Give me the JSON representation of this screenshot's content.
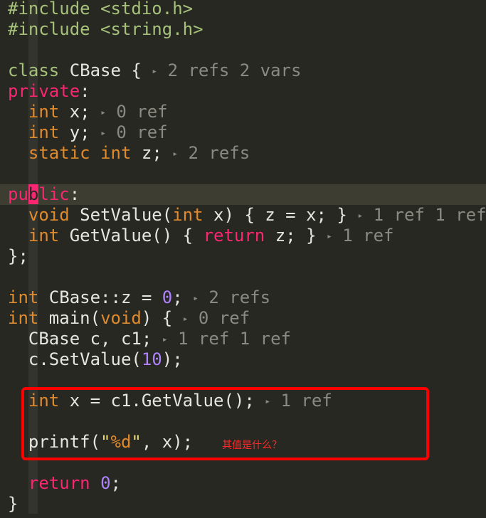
{
  "lines": [
    [
      {
        "c": "t-include",
        "t": "#include "
      },
      {
        "c": "t-include",
        "t": "<stdio.h>"
      }
    ],
    [
      {
        "c": "t-include",
        "t": "#include "
      },
      {
        "c": "t-include",
        "t": "<string.h>"
      }
    ],
    [],
    [
      {
        "c": "t-class",
        "t": "class "
      },
      {
        "c": "t-plain",
        "t": "CBase { "
      },
      {
        "c": "t-arrow",
        "t": "▸"
      },
      {
        "c": "t-hint",
        "t": " 2 refs 2 vars"
      }
    ],
    [
      {
        "c": "t-kw",
        "t": "private"
      },
      {
        "c": "t-plain",
        "t": ":"
      }
    ],
    [
      {
        "c": "t-plain",
        "t": "  "
      },
      {
        "c": "t-type",
        "t": "int"
      },
      {
        "c": "t-plain",
        "t": " x; "
      },
      {
        "c": "t-arrow",
        "t": "▸"
      },
      {
        "c": "t-hint",
        "t": " 0 ref"
      }
    ],
    [
      {
        "c": "t-plain",
        "t": "  "
      },
      {
        "c": "t-type",
        "t": "int"
      },
      {
        "c": "t-plain",
        "t": " y; "
      },
      {
        "c": "t-arrow",
        "t": "▸"
      },
      {
        "c": "t-hint",
        "t": " 0 ref"
      }
    ],
    [
      {
        "c": "t-plain",
        "t": "  "
      },
      {
        "c": "t-type",
        "t": "static"
      },
      {
        "c": "t-plain",
        "t": " "
      },
      {
        "c": "t-type",
        "t": "int"
      },
      {
        "c": "t-plain",
        "t": " z; "
      },
      {
        "c": "t-arrow",
        "t": "▸"
      },
      {
        "c": "t-hint",
        "t": " 2 refs"
      }
    ],
    [],
    [
      {
        "c": "t-kw",
        "t": "pu"
      },
      {
        "c": "t-kw cursor-block",
        "t": "b"
      },
      {
        "c": "t-kw",
        "t": "lic"
      },
      {
        "c": "t-plain",
        "t": ":"
      }
    ],
    [
      {
        "c": "t-plain",
        "t": "  "
      },
      {
        "c": "t-type",
        "t": "void"
      },
      {
        "c": "t-plain",
        "t": " SetValue("
      },
      {
        "c": "t-type",
        "t": "int"
      },
      {
        "c": "t-plain",
        "t": " x) { z = x; } "
      },
      {
        "c": "t-arrow",
        "t": "▸"
      },
      {
        "c": "t-hint",
        "t": " 1 ref 1 ref"
      }
    ],
    [
      {
        "c": "t-plain",
        "t": "  "
      },
      {
        "c": "t-type",
        "t": "int"
      },
      {
        "c": "t-plain",
        "t": " GetValue() { "
      },
      {
        "c": "t-kw",
        "t": "return"
      },
      {
        "c": "t-plain",
        "t": " z; } "
      },
      {
        "c": "t-arrow",
        "t": "▸"
      },
      {
        "c": "t-hint",
        "t": " 1 ref"
      }
    ],
    [
      {
        "c": "t-plain",
        "t": "};"
      }
    ],
    [],
    [
      {
        "c": "t-type",
        "t": "int"
      },
      {
        "c": "t-plain",
        "t": " CBase::z = "
      },
      {
        "c": "t-num",
        "t": "0"
      },
      {
        "c": "t-plain",
        "t": "; "
      },
      {
        "c": "t-arrow",
        "t": "▸"
      },
      {
        "c": "t-hint",
        "t": " 2 refs"
      }
    ],
    [
      {
        "c": "t-type",
        "t": "int"
      },
      {
        "c": "t-plain",
        "t": " main("
      },
      {
        "c": "t-type",
        "t": "void"
      },
      {
        "c": "t-plain",
        "t": ") { "
      },
      {
        "c": "t-arrow",
        "t": "▸"
      },
      {
        "c": "t-hint",
        "t": " 0 ref"
      }
    ],
    [
      {
        "c": "t-plain",
        "t": "  CBase c, c1; "
      },
      {
        "c": "t-arrow",
        "t": "▸"
      },
      {
        "c": "t-hint",
        "t": " 1 ref 1 ref"
      }
    ],
    [
      {
        "c": "t-plain",
        "t": "  c.SetValue("
      },
      {
        "c": "t-num",
        "t": "10"
      },
      {
        "c": "t-plain",
        "t": ");"
      }
    ],
    [],
    [
      {
        "c": "t-plain",
        "t": "  "
      },
      {
        "c": "t-type",
        "t": "int"
      },
      {
        "c": "t-plain",
        "t": " x = c1.GetValue(); "
      },
      {
        "c": "t-arrow",
        "t": "▸"
      },
      {
        "c": "t-hint",
        "t": " 1 ref"
      }
    ],
    [],
    [
      {
        "c": "t-plain",
        "t": "  printf("
      },
      {
        "c": "t-str",
        "t": "\""
      },
      {
        "c": "t-fmt",
        "t": "%d"
      },
      {
        "c": "t-str",
        "t": "\""
      },
      {
        "c": "t-plain",
        "t": ", x);"
      }
    ],
    [],
    [
      {
        "c": "t-plain",
        "t": "  "
      },
      {
        "c": "t-kw",
        "t": "return"
      },
      {
        "c": "t-plain",
        "t": " "
      },
      {
        "c": "t-num",
        "t": "0"
      },
      {
        "c": "t-plain",
        "t": ";"
      }
    ],
    [
      {
        "c": "t-plain",
        "t": "}"
      }
    ]
  ],
  "current_line": 9,
  "annotation": "其值是什么？"
}
